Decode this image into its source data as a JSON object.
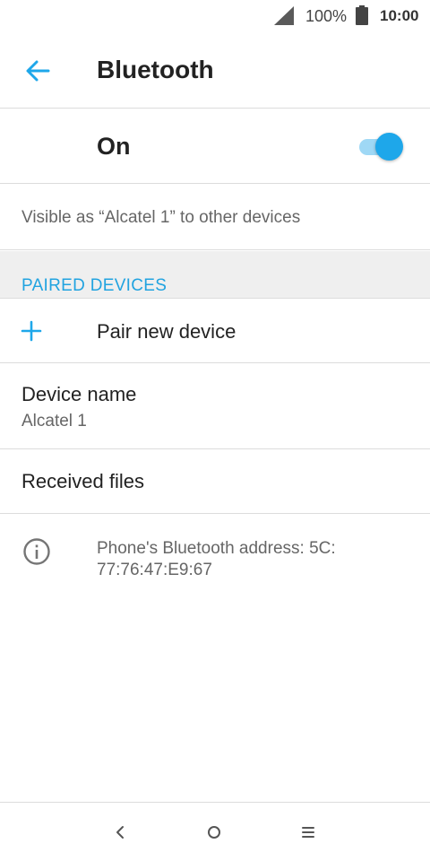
{
  "status_bar": {
    "battery_percent": "100%",
    "time": "10:00",
    "icons": [
      "signal-icon",
      "battery-icon"
    ]
  },
  "app_bar": {
    "title": "Bluetooth",
    "back_icon": "arrow-back-icon"
  },
  "bluetooth_toggle": {
    "label": "On",
    "checked": true
  },
  "visibility_text": "Visible as “Alcatel 1” to other devices",
  "paired_devices": {
    "header": "PAIRED DEVICES",
    "pair_new_label": "Pair new device"
  },
  "device_name": {
    "title": "Device name",
    "value": "Alcatel 1"
  },
  "received_files": {
    "title": "Received files"
  },
  "info": {
    "text": "Phone's Bluetooth address: 5C: 77:76:47:E9:67"
  },
  "nav_bar": {
    "icons": [
      "nav-back-icon",
      "nav-home-icon",
      "nav-recents-icon"
    ]
  },
  "colors": {
    "accent": "#1ea7ea",
    "divider": "#dcdcdc",
    "section_bg": "#efefef"
  }
}
